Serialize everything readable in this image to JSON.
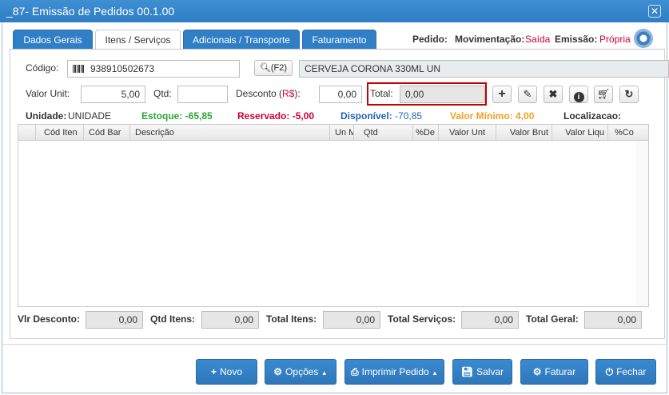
{
  "window": {
    "title": "_87- Emissão de Pedidos 00.1.00",
    "close": "✕"
  },
  "tabs": [
    "Dados Gerais",
    "Itens / Serviços",
    "Adicionais / Transporte",
    "Faturamento"
  ],
  "header": {
    "pedido_label": "Pedido:",
    "movimentacao_label": "Movimentação:",
    "movimentacao_value": "Saída",
    "emissao_label": "Emissão:",
    "emissao_value": "Própria"
  },
  "form": {
    "codigo_label": "Código:",
    "codigo_value": "938910502673",
    "search_label": "(F2)",
    "produto_value": "CERVEJA CORONA 330ML UN",
    "valor_unit_label": "Valor Unit:",
    "valor_unit_value": "5,00",
    "qtd_label": "Qtd:",
    "qtd_value": "",
    "desconto_label": "Desconto",
    "desconto_unit_open": "(",
    "desconto_unit": "R$",
    "desconto_unit_close": "):",
    "desconto_value": "0,00",
    "total_label": "Total:",
    "total_value": "0,00"
  },
  "info": {
    "unidade_label": "Unidade:",
    "unidade_value": "UNIDADE",
    "estoque": "Estoque: -65,85",
    "reservado": "Reservado: -5,00",
    "disponivel_label": "Disponível:",
    "disponivel_value": "-70,85",
    "valor_minimo": "Valor Mínimo: 4,00",
    "localizacao": "Localizacao:"
  },
  "colors": {
    "green": "#2aa63a",
    "red": "#cc0033",
    "blue": "#1f64b5",
    "orange": "#f0a020",
    "primary": "#2f7ec6"
  },
  "grid": {
    "columns": [
      "",
      "Cód Iten",
      "Cód Bar",
      "Descrição",
      "Un M",
      "Qtd",
      "%De",
      "Valor Unt",
      "Valor Brut",
      "Valor Liqu",
      "%Co"
    ]
  },
  "totals": {
    "vlr_desconto_label": "Vlr Desconto:",
    "vlr_desconto_value": "0,00",
    "qtd_itens_label": "Qtd Itens:",
    "qtd_itens_value": "0,00",
    "total_itens_label": "Total Itens:",
    "total_itens_value": "0,00",
    "total_servicos_label": "Total Serviços:",
    "total_servicos_value": "0,00",
    "total_geral_label": "Total Geral:",
    "total_geral_value": "0,00"
  },
  "buttons": {
    "novo": "Novo",
    "opcoes": "Opções",
    "imprimir": "Imprimir Pedido",
    "salvar": "Salvar",
    "faturar": "Faturar",
    "fechar": "Fechar"
  },
  "icons": [
    "plus-icon",
    "edit-icon",
    "remove-icon",
    "info-icon",
    "cart-icon",
    "refresh-icon",
    "search-icon",
    "barcode-icon",
    "gear-icon"
  ]
}
